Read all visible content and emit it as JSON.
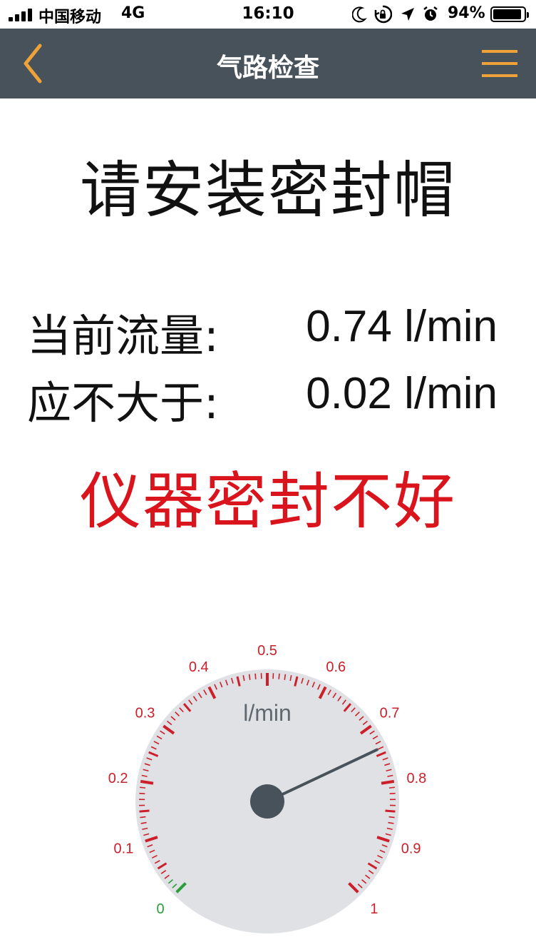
{
  "status_bar": {
    "carrier": "中国移动",
    "network": "4G",
    "time": "16:10",
    "battery_percent": "94%",
    "battery_level": 0.94,
    "icons": [
      "moon-icon",
      "orientation-lock-icon",
      "location-arrow-icon",
      "alarm-icon"
    ]
  },
  "nav": {
    "title": "气路检查",
    "back_icon": "chevron-left-icon",
    "menu_icon": "hamburger-menu-icon",
    "accent_color": "#f0a23a",
    "background_color": "#47525b"
  },
  "main": {
    "instruction": "请安装密封帽",
    "current_flow_label": "当前流量:",
    "current_flow_value": "0.74 l/min",
    "max_flow_label": "应不大于:",
    "max_flow_value": "0.02 l/min",
    "result": "仪器密封不好",
    "result_color": "#d9141c"
  },
  "gauge": {
    "unit": "l/min",
    "min": 0,
    "max": 1,
    "value": 0.74,
    "threshold": 0.02,
    "tick_labels": [
      "0",
      "0.1",
      "0.2",
      "0.3",
      "0.4",
      "0.5",
      "0.6",
      "0.7",
      "0.8",
      "0.9",
      "1"
    ],
    "ok_color": "#2a9d3c",
    "bad_color": "#cc1f2a",
    "face_color": "#dfe1e5",
    "needle_color": "#47525b"
  }
}
